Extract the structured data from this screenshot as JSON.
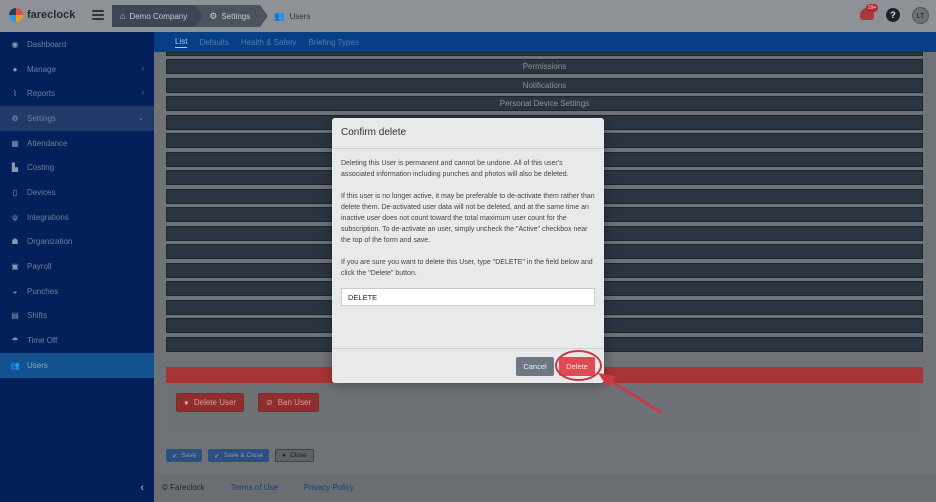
{
  "app": {
    "name": "fareclock"
  },
  "breadcrumb": [
    "Demo Company",
    "Settings",
    "Users"
  ],
  "header": {
    "notification_count": "29+",
    "help_label": "?",
    "user_initials": "LT"
  },
  "sidebar": {
    "items": [
      {
        "label": "Dashboard",
        "icon": "dashboard-icon"
      },
      {
        "label": "Manage",
        "icon": "person-icon"
      },
      {
        "label": "Reports",
        "icon": "chart-icon"
      },
      {
        "label": "Settings",
        "icon": "gear-icon"
      },
      {
        "label": "Attendance",
        "icon": "calendar-icon"
      },
      {
        "label": "Costing",
        "icon": "factory-icon"
      },
      {
        "label": "Devices",
        "icon": "tablet-icon"
      },
      {
        "label": "Integrations",
        "icon": "plug-icon"
      },
      {
        "label": "Organization",
        "icon": "org-chart-icon"
      },
      {
        "label": "Payroll",
        "icon": "money-icon"
      },
      {
        "label": "Punches",
        "icon": "punch-clock-icon"
      },
      {
        "label": "Shifts",
        "icon": "calendar-check-icon"
      },
      {
        "label": "Time Off",
        "icon": "beach-umbrella-icon"
      },
      {
        "label": "Users",
        "icon": "users-icon"
      }
    ]
  },
  "subnav": {
    "tabs": [
      "List",
      "Defaults",
      "Health & Safety",
      "Briefing Types"
    ]
  },
  "sections": [
    "Permissions",
    "Notifications",
    "Personal Device Settings"
  ],
  "actions": {
    "delete_user": "Delete User",
    "ban_user": "Ban User"
  },
  "footer_buttons": {
    "save": "Save",
    "save_close": "Save & Close",
    "close": "Close"
  },
  "footer": {
    "copyright": "© Fareclock",
    "terms": "Terms of Use",
    "privacy": "Privacy Policy"
  },
  "modal": {
    "title": "Confirm delete",
    "paragraph_1": "Deleting this User is permanent and cannot be undone. All of this user's associated information including punches and photos will also be deleted.",
    "paragraph_2": "If this user is no longer active, it may be preferable to de-activate them rather than delete them. De-activated user data will not be deleted, and at the same time an inactive user does not count toward the total maximum user count for the subscription. To de-activate an user, simply uncheck the \"Active\" checkbox near the top of the form and save.",
    "paragraph_3": "If you are sure you want to delete this User, type \"DELETE\" in the field below and click the \"Delete\" button.",
    "input_value": "DELETE",
    "cancel_label": "Cancel",
    "delete_label": "Delete"
  },
  "colors": {
    "sidebar": "#04205a",
    "subnav": "#073f86",
    "danger": "#e04b53",
    "highlight": "#c73a48"
  }
}
